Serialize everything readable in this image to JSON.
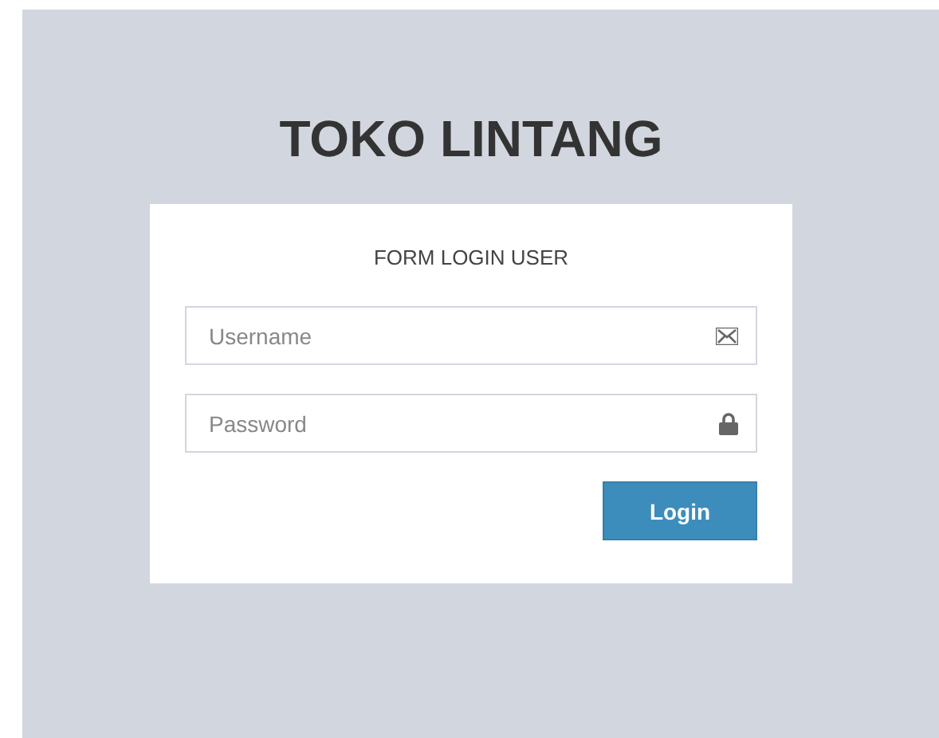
{
  "title": "TOKO LINTANG",
  "form": {
    "heading": "FORM LOGIN USER",
    "fields": [
      {
        "kind": "email",
        "placeholder": "Username"
      },
      {
        "kind": "password",
        "placeholder": "Password"
      }
    ],
    "button": "Login"
  }
}
